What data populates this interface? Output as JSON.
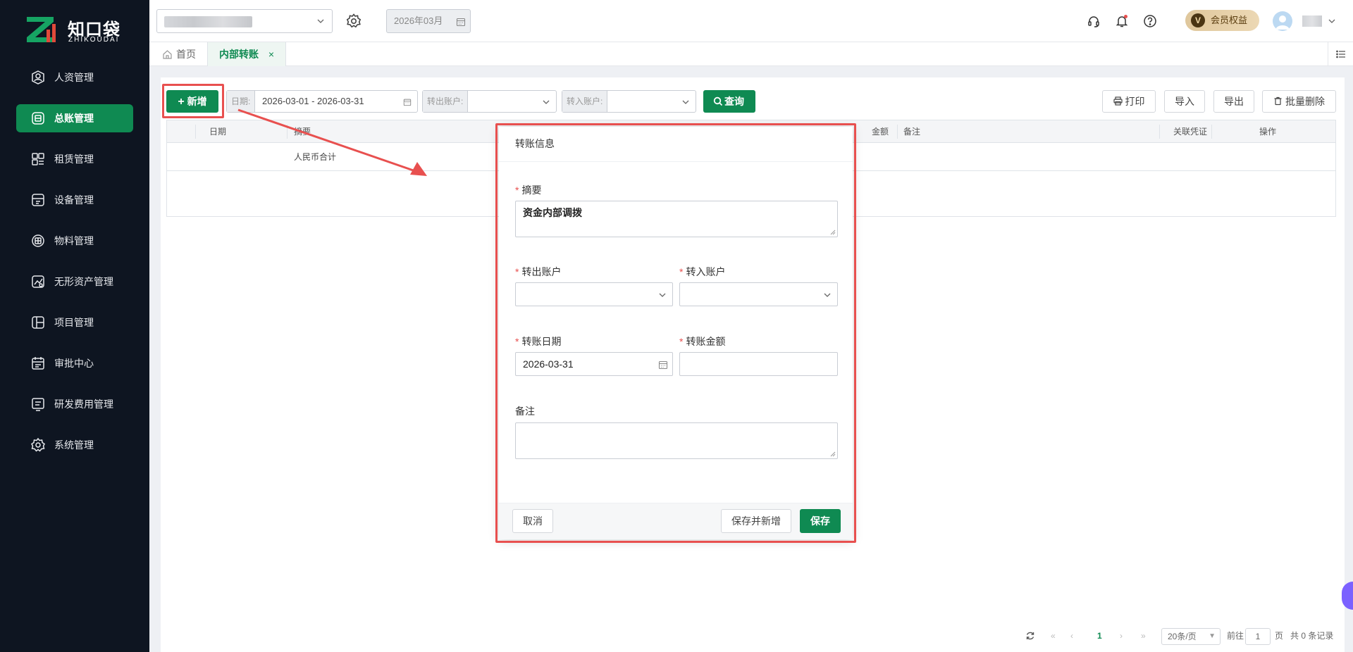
{
  "brand": {
    "name": "知口袋",
    "sub": "ZHIKOUDAI",
    "accent": "#0f8a52"
  },
  "sidebar": {
    "items": [
      {
        "label": "人资管理",
        "icon": "person-badge-icon",
        "active": false
      },
      {
        "label": "总账管理",
        "icon": "ledger-icon",
        "active": true
      },
      {
        "label": "租赁管理",
        "icon": "lease-icon",
        "active": false
      },
      {
        "label": "设备管理",
        "icon": "device-icon",
        "active": false
      },
      {
        "label": "物料管理",
        "icon": "material-icon",
        "active": false
      },
      {
        "label": "无形资产管理",
        "icon": "intangible-asset-icon",
        "active": false
      },
      {
        "label": "项目管理",
        "icon": "project-icon",
        "active": false
      },
      {
        "label": "审批中心",
        "icon": "approval-icon",
        "active": false
      },
      {
        "label": "研发费用管理",
        "icon": "rd-expense-icon",
        "active": false
      },
      {
        "label": "系统管理",
        "icon": "gear-icon",
        "active": false
      }
    ]
  },
  "header": {
    "period": "2026年03月",
    "member_label": "会员权益",
    "member_badge_letter": "V"
  },
  "tabs": {
    "home": "首页",
    "active": "内部转账",
    "close": "×"
  },
  "toolbar": {
    "add_label": "新增",
    "date_label": "日期:",
    "date_range": "2026-03-01 - 2026-03-31",
    "out_account_label": "转出账户:",
    "in_account_label": "转入账户:",
    "query_label": "查询",
    "print_label": "打印",
    "import_label": "导入",
    "export_label": "导出",
    "batch_delete_label": "批量删除"
  },
  "table": {
    "columns": [
      "日期",
      "摘要",
      "金额",
      "备注",
      "关联凭证",
      "操作"
    ],
    "summary_row": "人民币合计"
  },
  "pagination": {
    "current_page": "1",
    "page_size": "20条/页",
    "goto_prefix": "前往",
    "goto_value": "1",
    "goto_suffix": "页",
    "total": "共 0 条记录"
  },
  "modal": {
    "title": "转账信息",
    "summary_label": "摘要",
    "summary_value": "资金内部调拨",
    "out_account_label": "转出账户",
    "in_account_label": "转入账户",
    "date_label": "转账日期",
    "date_value": "2026-03-31",
    "amount_label": "转账金额",
    "amount_value": "",
    "remark_label": "备注",
    "remark_value": "",
    "cancel_label": "取消",
    "save_new_label": "保存并新增",
    "save_label": "保存",
    "required_mark": "*"
  },
  "colors": {
    "highlight": "#e8504f",
    "sidebar_bg": "#0e1521",
    "primary": "#0f8a52"
  }
}
